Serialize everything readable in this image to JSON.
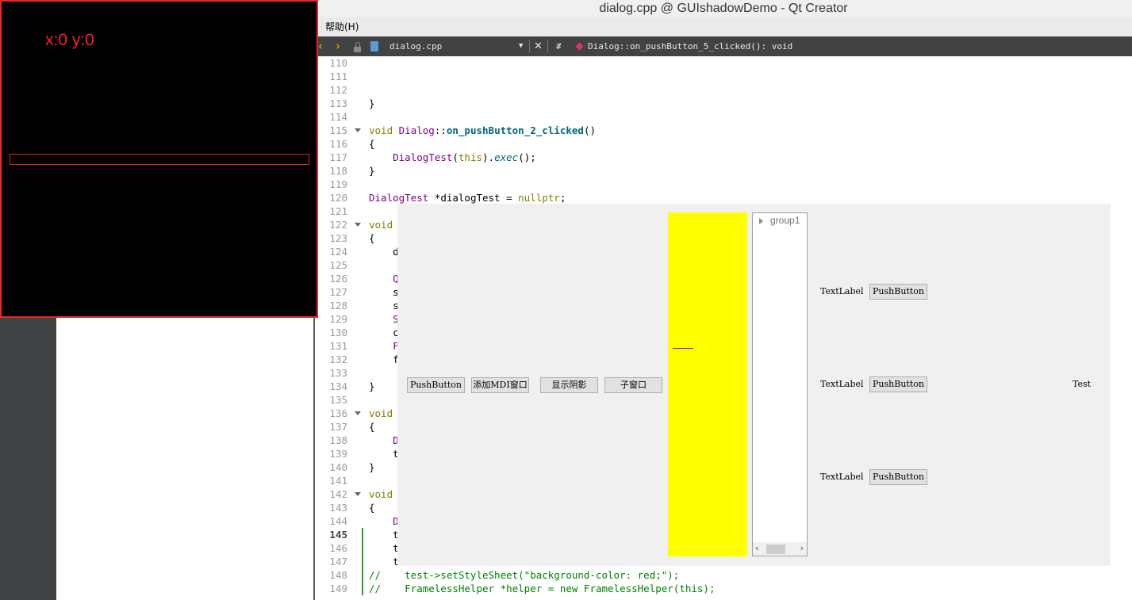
{
  "window_title": "dialog.cpp @ GUIshadowDemo - Qt Creator",
  "menu": {
    "help": "帮助(H)"
  },
  "editor_toolbar": {
    "back_icon": "‹",
    "forward_icon": "›",
    "file_name": "dialog.cpp",
    "dropdown_icon": "▼",
    "close_icon": "✕",
    "hash": "#",
    "symbol": "Dialog::on_pushButton_5_clicked(): void"
  },
  "code_lines": [
    {
      "n": "110",
      "fold": false,
      "changed": false,
      "current": false,
      "parts": []
    },
    {
      "n": "111",
      "fold": false,
      "changed": false,
      "current": false,
      "parts": []
    },
    {
      "n": "112",
      "fold": false,
      "changed": false,
      "current": false,
      "parts": []
    },
    {
      "n": "113",
      "fold": false,
      "changed": false,
      "current": false,
      "parts": [
        {
          "t": "}",
          "c": ""
        }
      ]
    },
    {
      "n": "114",
      "fold": false,
      "changed": false,
      "current": false,
      "parts": []
    },
    {
      "n": "115",
      "fold": true,
      "changed": false,
      "current": false,
      "parts": [
        {
          "t": "void ",
          "c": "kw"
        },
        {
          "t": "Dialog",
          "c": "ty"
        },
        {
          "t": "::",
          "c": ""
        },
        {
          "t": "on_pushButton_2_clicked",
          "c": "fn"
        },
        {
          "t": "()",
          "c": ""
        }
      ]
    },
    {
      "n": "116",
      "fold": false,
      "changed": false,
      "current": false,
      "parts": [
        {
          "t": "{",
          "c": ""
        }
      ]
    },
    {
      "n": "117",
      "fold": false,
      "changed": false,
      "current": false,
      "parts": [
        {
          "t": "    ",
          "c": ""
        },
        {
          "t": "DialogTest",
          "c": "ty"
        },
        {
          "t": "(",
          "c": ""
        },
        {
          "t": "this",
          "c": "kw"
        },
        {
          "t": ").",
          "c": ""
        },
        {
          "t": "exec",
          "c": "it"
        },
        {
          "t": "();",
          "c": ""
        }
      ]
    },
    {
      "n": "118",
      "fold": false,
      "changed": false,
      "current": false,
      "parts": [
        {
          "t": "}",
          "c": ""
        }
      ]
    },
    {
      "n": "119",
      "fold": false,
      "changed": false,
      "current": false,
      "parts": []
    },
    {
      "n": "120",
      "fold": false,
      "changed": false,
      "current": false,
      "parts": [
        {
          "t": "DialogTest",
          "c": "ty"
        },
        {
          "t": " *dialogTest = ",
          "c": ""
        },
        {
          "t": "nullptr",
          "c": "kw"
        },
        {
          "t": ";",
          "c": ""
        }
      ]
    },
    {
      "n": "121",
      "fold": false,
      "changed": false,
      "current": false,
      "parts": []
    },
    {
      "n": "122",
      "fold": true,
      "changed": false,
      "current": false,
      "parts": [
        {
          "t": "void",
          "c": "kw"
        }
      ]
    },
    {
      "n": "123",
      "fold": false,
      "changed": false,
      "current": false,
      "parts": [
        {
          "t": "{",
          "c": ""
        }
      ]
    },
    {
      "n": "124",
      "fold": false,
      "changed": false,
      "current": false,
      "parts": [
        {
          "t": "    d",
          "c": ""
        }
      ]
    },
    {
      "n": "125",
      "fold": false,
      "changed": false,
      "current": false,
      "parts": []
    },
    {
      "n": "126",
      "fold": false,
      "changed": false,
      "current": false,
      "parts": [
        {
          "t": "    ",
          "c": ""
        },
        {
          "t": "Q",
          "c": "ty"
        }
      ]
    },
    {
      "n": "127",
      "fold": false,
      "changed": false,
      "current": false,
      "parts": [
        {
          "t": "    s",
          "c": ""
        }
      ]
    },
    {
      "n": "128",
      "fold": false,
      "changed": false,
      "current": false,
      "parts": [
        {
          "t": "    s",
          "c": ""
        }
      ]
    },
    {
      "n": "129",
      "fold": false,
      "changed": false,
      "current": false,
      "parts": [
        {
          "t": "    ",
          "c": ""
        },
        {
          "t": "S",
          "c": "ty"
        }
      ]
    },
    {
      "n": "130",
      "fold": false,
      "changed": false,
      "current": false,
      "parts": [
        {
          "t": "    c",
          "c": ""
        }
      ]
    },
    {
      "n": "131",
      "fold": false,
      "changed": false,
      "current": false,
      "parts": [
        {
          "t": "    ",
          "c": ""
        },
        {
          "t": "F",
          "c": "ty"
        }
      ]
    },
    {
      "n": "132",
      "fold": false,
      "changed": false,
      "current": false,
      "parts": [
        {
          "t": "    f",
          "c": ""
        }
      ]
    },
    {
      "n": "133",
      "fold": false,
      "changed": false,
      "current": false,
      "parts": []
    },
    {
      "n": "134",
      "fold": false,
      "changed": false,
      "current": false,
      "parts": [
        {
          "t": "}",
          "c": ""
        }
      ]
    },
    {
      "n": "135",
      "fold": false,
      "changed": false,
      "current": false,
      "parts": []
    },
    {
      "n": "136",
      "fold": true,
      "changed": false,
      "current": false,
      "parts": [
        {
          "t": "void",
          "c": "kw"
        }
      ]
    },
    {
      "n": "137",
      "fold": false,
      "changed": false,
      "current": false,
      "parts": [
        {
          "t": "{",
          "c": ""
        }
      ]
    },
    {
      "n": "138",
      "fold": false,
      "changed": false,
      "current": false,
      "parts": [
        {
          "t": "    ",
          "c": ""
        },
        {
          "t": "D",
          "c": "ty"
        }
      ]
    },
    {
      "n": "139",
      "fold": false,
      "changed": false,
      "current": false,
      "parts": [
        {
          "t": "    t",
          "c": ""
        }
      ]
    },
    {
      "n": "140",
      "fold": false,
      "changed": false,
      "current": false,
      "parts": [
        {
          "t": "}",
          "c": ""
        }
      ]
    },
    {
      "n": "141",
      "fold": false,
      "changed": false,
      "current": false,
      "parts": []
    },
    {
      "n": "142",
      "fold": true,
      "changed": false,
      "current": false,
      "parts": [
        {
          "t": "void",
          "c": "kw"
        }
      ]
    },
    {
      "n": "143",
      "fold": false,
      "changed": false,
      "current": false,
      "parts": [
        {
          "t": "{",
          "c": ""
        }
      ]
    },
    {
      "n": "144",
      "fold": false,
      "changed": false,
      "current": false,
      "parts": [
        {
          "t": "    ",
          "c": ""
        },
        {
          "t": "D",
          "c": "ty"
        }
      ]
    },
    {
      "n": "145",
      "fold": false,
      "changed": true,
      "current": true,
      "parts": [
        {
          "t": "    t",
          "c": ""
        }
      ]
    },
    {
      "n": "146",
      "fold": false,
      "changed": true,
      "current": false,
      "parts": [
        {
          "t": "    t",
          "c": ""
        }
      ]
    },
    {
      "n": "147",
      "fold": false,
      "changed": true,
      "current": false,
      "parts": [
        {
          "t": "    t",
          "c": ""
        }
      ]
    },
    {
      "n": "148",
      "fold": false,
      "changed": true,
      "current": false,
      "parts": [
        {
          "t": "//    test->setStyleSheet(\"background-color: red;\");",
          "c": "cm"
        }
      ]
    },
    {
      "n": "149",
      "fold": false,
      "changed": true,
      "current": false,
      "parts": [
        {
          "t": "//    FramelessHelper *helper = new FramelessHelper(this);",
          "c": "cm"
        }
      ]
    }
  ],
  "dialog": {
    "buttons": {
      "push": "PushButton",
      "add_mdi": "添加MDI窗口",
      "show_shadow": "显示阴影",
      "sub_window": "子窗口"
    },
    "tree": {
      "item": "group1",
      "scroll_left": "‹",
      "scroll_right": "›"
    },
    "form_rows": [
      {
        "label": "TextLabel",
        "button": "PushButton"
      },
      {
        "label": "TextLabel",
        "button": "PushButton"
      },
      {
        "label": "TextLabel",
        "button": "PushButton"
      }
    ],
    "test_label": "Test"
  },
  "shadow_window": {
    "coords": "x:0 y:0"
  },
  "colors": {
    "shadow_border": "#e8291c",
    "coords_text": "#ff2020",
    "yellow_widget": "#ffff00",
    "toolbar_bg": "#404244"
  }
}
